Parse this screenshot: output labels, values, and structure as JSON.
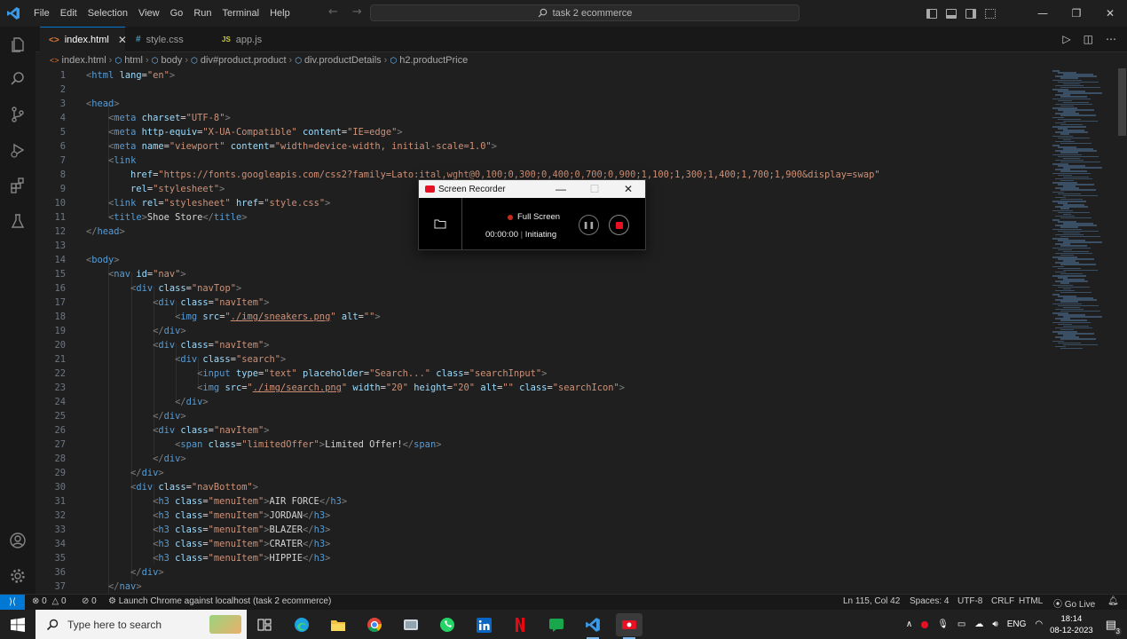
{
  "menu": [
    "File",
    "Edit",
    "Selection",
    "View",
    "Go",
    "Run",
    "Terminal",
    "Help"
  ],
  "search_center": "task 2 ecommerce",
  "tabs": [
    {
      "icon": "<>",
      "label": "index.html",
      "active": true
    },
    {
      "icon": "#",
      "label": "style.css",
      "active": false
    },
    {
      "icon": "JS",
      "label": "app.js",
      "active": false
    }
  ],
  "breadcrumb": [
    "index.html",
    "html",
    "body",
    "div#product.product",
    "div.productDetails",
    "h2.productPrice"
  ],
  "recorder": {
    "title": "Screen Recorder",
    "mode": "Full Screen",
    "time": "00:00:00",
    "status": "Initiating"
  },
  "statusbar": {
    "errors": "0",
    "warnings": "0",
    "ports": "0",
    "launch": "Launch Chrome against localhost (task 2 ecommerce)",
    "cursor": "Ln 115, Col 42",
    "spaces": "Spaces: 4",
    "encoding": "UTF-8",
    "eol": "CRLF",
    "language": "HTML",
    "golive": "Go Live"
  },
  "taskbar": {
    "search_placeholder": "Type here to search",
    "lang": "ENG",
    "time": "18:14",
    "date": "08-12-2023",
    "notif_count": "3"
  },
  "colors": {
    "accent": "#0078d4",
    "editor_bg": "#1f1f1f",
    "tag": "#569cd6",
    "attr": "#9cdcfe",
    "string": "#ce9178"
  }
}
